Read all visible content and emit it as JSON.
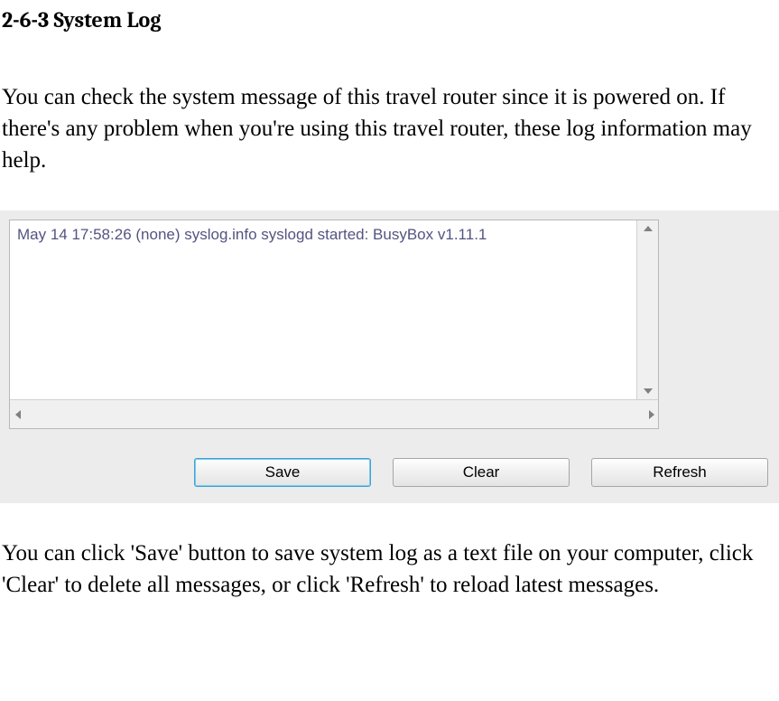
{
  "heading": "2-6-3 System Log",
  "intro": "You can check the system message of this travel router since it is powered on. If there's any problem when you're using this travel router, these log information may help.",
  "log_line": "May 14 17:58:26 (none) syslog.info syslogd started: BusyBox v1.11.1",
  "buttons": {
    "save": "Save",
    "clear": "Clear",
    "refresh": "Refresh"
  },
  "outro": "You can click 'Save' button to save system log as a text file on your computer, click 'Clear' to delete all messages, or click 'Refresh' to reload latest messages."
}
